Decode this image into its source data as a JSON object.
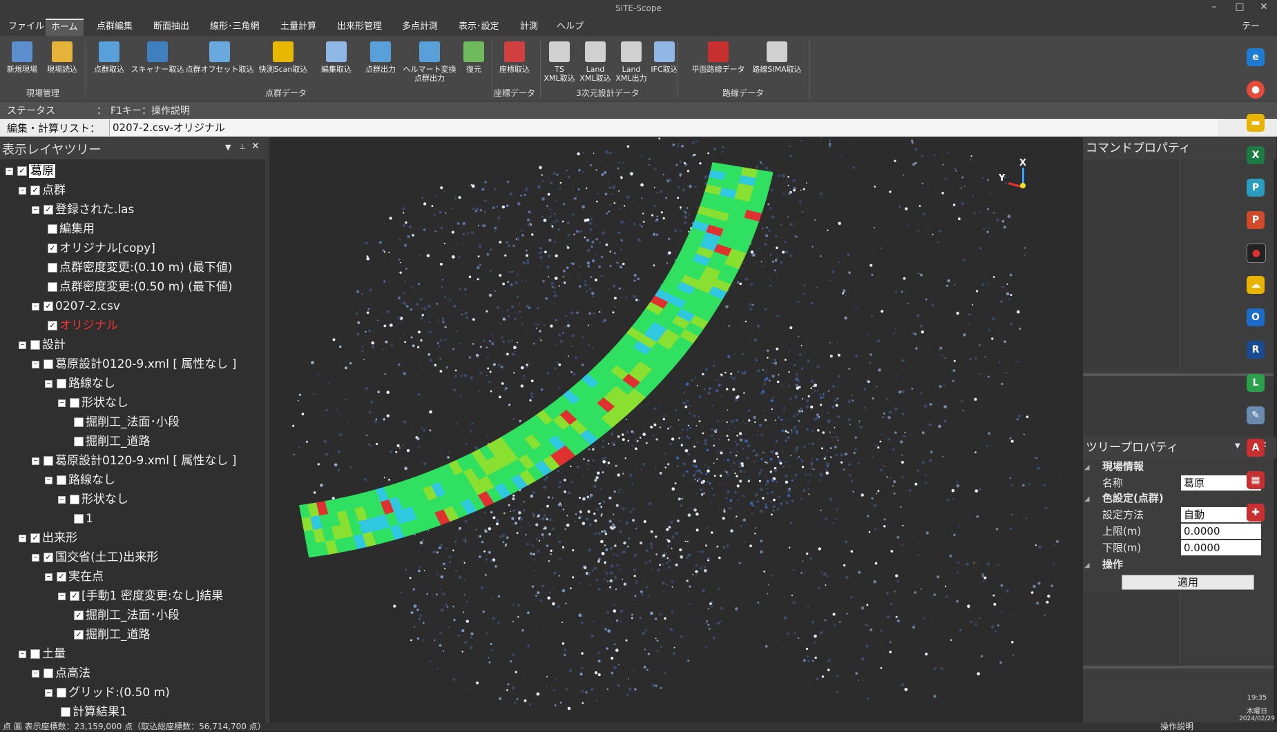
{
  "window": {
    "title": "SiTE-Scope",
    "minimize": "–",
    "maximize": "□",
    "close": "✕"
  },
  "menu": [
    "ファイル",
    "ホーム",
    "点群編集",
    "断面抽出",
    "線形･三角網",
    "土量計算",
    "出来形管理",
    "多点計測",
    "表示･設定",
    "計測",
    "ヘルプ"
  ],
  "menu_extra": "テー",
  "ribbon": {
    "buttons": [
      {
        "label": "新規現場",
        "color": "#5b8fd0"
      },
      {
        "label": "現場読込",
        "color": "#e6b33a"
      },
      {
        "label": "点群取込",
        "color": "#5aa0d8"
      },
      {
        "label": "スキャナー取込",
        "color": "#3f7fc0"
      },
      {
        "label": "点群オフセット取込",
        "color": "#6aa8e0"
      },
      {
        "label": "快測Scan取込",
        "color": "#e8b800"
      },
      {
        "label": "編集取込",
        "color": "#8fb8e6"
      },
      {
        "label": "点群出力",
        "color": "#5aa0d8"
      },
      {
        "label": "ヘルマート変換\n点群出力",
        "color": "#5aa0d8"
      },
      {
        "label": "復元",
        "color": "#6dbb5a"
      },
      {
        "label": "座標取込",
        "color": "#d04040"
      },
      {
        "label": "TS\nXML取込",
        "color": "#d0d0d0"
      },
      {
        "label": "Land\nXML取込",
        "color": "#d0d0d0"
      },
      {
        "label": "Land\nXML出力",
        "color": "#d0d0d0"
      },
      {
        "label": "IFC取込",
        "color": "#8fb8e6"
      },
      {
        "label": "平面路線データ",
        "color": "#c83030"
      },
      {
        "label": "路線SIMA取込",
        "color": "#d0d0d0"
      }
    ],
    "groups": [
      "現場管理",
      "点群データ",
      "座標データ",
      "3次元設計データ",
      "路線データ"
    ]
  },
  "status": {
    "label": "ステータス",
    "sep": "：",
    "text": "F1キー：操作説明"
  },
  "edit_list": {
    "label": "編集・計算リスト：",
    "value": "0207-2.csv-オリジナル"
  },
  "layer_tree": {
    "title": "表示レイヤツリー",
    "items": [
      "葛原",
      "点群",
      "登録された.las",
      "編集用",
      "オリジナル[copy]",
      "点群密度変更:(0.10 m) (最下値)",
      "点群密度変更:(0.50 m) (最下値)",
      "0207-2.csv",
      "オリジナル",
      "設計",
      "葛原設計0120-9.xml [ 属性なし ]",
      "路線なし",
      "形状なし",
      "掘削工_法面･小段",
      "掘削工_道路",
      "葛原設計0120-9.xml [ 属性なし ]",
      "路線なし",
      "形状なし",
      "1",
      "出来形",
      "国交省(土工)出来形",
      "実在点",
      "[手動1 密度変更:なし]結果",
      "掘削工_法面･小段",
      "掘削工_道路",
      "土量",
      "点高法",
      "グリッド:(0.50 m)",
      "計算結果1"
    ]
  },
  "command_props": {
    "title": "コマンドプロパティ"
  },
  "tree_props": {
    "title": "ツリープロパティ",
    "sections": [
      "現場情報",
      "色設定(点群)",
      "操作"
    ],
    "rows": [
      {
        "key": "名称",
        "value": "葛原"
      },
      {
        "key": "設定方法",
        "value": "自動"
      },
      {
        "key": "上限(m)",
        "value": "0.0000"
      },
      {
        "key": "下限(m)",
        "value": "0.0000"
      }
    ],
    "apply_button": "適用"
  },
  "axes": {
    "x": "X",
    "y": "Y"
  },
  "bottom_status": {
    "left": "点  画  表示座標数：23,159,000 点（取込総座標数：56,714,700 点）",
    "right": "操作説明"
  },
  "taskbar": {
    "time": "19:35",
    "day": "木曜日",
    "date": "2024/02/29"
  }
}
